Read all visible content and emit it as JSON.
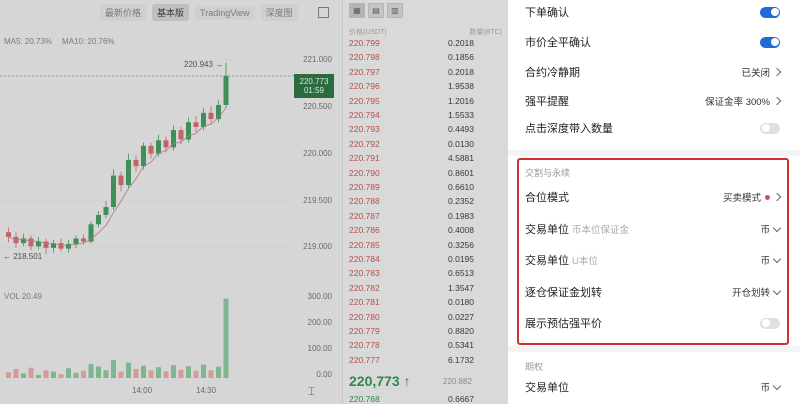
{
  "chart": {
    "toolbar": [
      "最新价格",
      "基本版",
      "TradingView",
      "深度图"
    ],
    "ma_legend": [
      "MA5: 20.73%",
      "MA10: 20.76%"
    ],
    "vol_legend": "VOL 20.49",
    "price_ticks": [
      "221.000",
      "220.500",
      "220.000",
      "219.500",
      "219.000"
    ],
    "vol_ticks": [
      "300.00",
      "200.00",
      "100.00",
      "0.00"
    ],
    "time_ticks": [
      "14:00",
      "14:30"
    ],
    "high_label": "220.943 →",
    "low_label": "← 218.501",
    "current_price_tag": {
      "price": "220.773",
      "sub": "01:59"
    },
    "candles": [
      {
        "o": 218.78,
        "c": 218.72,
        "h": 218.84,
        "l": 218.65
      },
      {
        "o": 218.72,
        "c": 218.64,
        "h": 218.78,
        "l": 218.58
      },
      {
        "o": 218.64,
        "c": 218.7,
        "h": 218.76,
        "l": 218.6
      },
      {
        "o": 218.7,
        "c": 218.6,
        "h": 218.74,
        "l": 218.55
      },
      {
        "o": 218.6,
        "c": 218.66,
        "h": 218.72,
        "l": 218.56
      },
      {
        "o": 218.66,
        "c": 218.58,
        "h": 218.7,
        "l": 218.5
      },
      {
        "o": 218.58,
        "c": 218.64,
        "h": 218.68,
        "l": 218.52
      },
      {
        "o": 218.64,
        "c": 218.57,
        "h": 218.7,
        "l": 218.53
      },
      {
        "o": 218.57,
        "c": 218.63,
        "h": 218.68,
        "l": 218.52
      },
      {
        "o": 218.63,
        "c": 218.7,
        "h": 218.74,
        "l": 218.58
      },
      {
        "o": 218.7,
        "c": 218.66,
        "h": 218.75,
        "l": 218.62
      },
      {
        "o": 218.66,
        "c": 218.88,
        "h": 218.92,
        "l": 218.64
      },
      {
        "o": 218.88,
        "c": 219.0,
        "h": 219.05,
        "l": 218.84
      },
      {
        "o": 219.0,
        "c": 219.1,
        "h": 219.18,
        "l": 218.96
      },
      {
        "o": 219.1,
        "c": 219.5,
        "h": 219.58,
        "l": 219.06
      },
      {
        "o": 219.5,
        "c": 219.38,
        "h": 219.55,
        "l": 219.3
      },
      {
        "o": 219.38,
        "c": 219.7,
        "h": 219.78,
        "l": 219.34
      },
      {
        "o": 219.7,
        "c": 219.62,
        "h": 219.76,
        "l": 219.55
      },
      {
        "o": 219.62,
        "c": 219.88,
        "h": 219.92,
        "l": 219.58
      },
      {
        "o": 219.88,
        "c": 219.78,
        "h": 219.92,
        "l": 219.72
      },
      {
        "o": 219.78,
        "c": 219.95,
        "h": 220.02,
        "l": 219.74
      },
      {
        "o": 219.95,
        "c": 219.86,
        "h": 220.0,
        "l": 219.8
      },
      {
        "o": 219.86,
        "c": 220.08,
        "h": 220.14,
        "l": 219.82
      },
      {
        "o": 220.08,
        "c": 219.96,
        "h": 220.12,
        "l": 219.9
      },
      {
        "o": 219.96,
        "c": 220.18,
        "h": 220.24,
        "l": 219.92
      },
      {
        "o": 220.18,
        "c": 220.12,
        "h": 220.26,
        "l": 220.06
      },
      {
        "o": 220.12,
        "c": 220.3,
        "h": 220.36,
        "l": 220.08
      },
      {
        "o": 220.3,
        "c": 220.22,
        "h": 220.38,
        "l": 220.16
      },
      {
        "o": 220.22,
        "c": 220.4,
        "h": 220.46,
        "l": 220.18
      },
      {
        "o": 220.4,
        "c": 220.77,
        "h": 220.94,
        "l": 220.36
      }
    ],
    "volumes": [
      22,
      35,
      18,
      40,
      12,
      30,
      25,
      15,
      38,
      20,
      28,
      55,
      45,
      30,
      70,
      25,
      60,
      35,
      48,
      30,
      42,
      26,
      50,
      32,
      46,
      28,
      52,
      30,
      44,
      310
    ]
  },
  "orderbook": {
    "header": {
      "price": "价格(USDT)",
      "qty": "数量(BTC)"
    },
    "asks": [
      {
        "p": "220.799",
        "q": "0.2018"
      },
      {
        "p": "220.798",
        "q": "0.1856"
      },
      {
        "p": "220.797",
        "q": "0.2018"
      },
      {
        "p": "220.796",
        "q": "1.9538"
      },
      {
        "p": "220.795",
        "q": "1.2016"
      },
      {
        "p": "220.794",
        "q": "1.5533"
      },
      {
        "p": "220.793",
        "q": "0.4493"
      },
      {
        "p": "220.792",
        "q": "0.0130"
      },
      {
        "p": "220.791",
        "q": "4.5881"
      },
      {
        "p": "220.790",
        "q": "0.8601"
      },
      {
        "p": "220.789",
        "q": "0.6610"
      },
      {
        "p": "220.788",
        "q": "0.2352"
      },
      {
        "p": "220.787",
        "q": "0.1983"
      },
      {
        "p": "220.786",
        "q": "0.4008"
      },
      {
        "p": "220.785",
        "q": "0.3256"
      },
      {
        "p": "220.784",
        "q": "0.0195"
      },
      {
        "p": "220.783",
        "q": "0.6513"
      },
      {
        "p": "220.782",
        "q": "1.3547"
      },
      {
        "p": "220.781",
        "q": "0.0180"
      },
      {
        "p": "220.780",
        "q": "0.0227"
      },
      {
        "p": "220.779",
        "q": "0.8820"
      },
      {
        "p": "220.778",
        "q": "0.5341"
      },
      {
        "p": "220.777",
        "q": "6.1732"
      }
    ],
    "last_price": "220,773 ↑",
    "last_price_sub": "220.882",
    "bid": {
      "p": "220.768",
      "q": "0.6667"
    }
  },
  "settings": {
    "rows_top": [
      {
        "label": "下单确认",
        "type": "toggle",
        "on": true
      },
      {
        "label": "市价全平确认",
        "type": "toggle",
        "on": true
      },
      {
        "label": "合约冷静期",
        "type": "link",
        "value": "已关闭"
      },
      {
        "label": "强平提醒",
        "type": "link",
        "value": "保证金率 300%"
      },
      {
        "label": "点击深度带入数量",
        "type": "toggle",
        "on": false
      }
    ],
    "section_trade": "交割与永续",
    "position_mode": {
      "label": "合位模式",
      "value": "买卖模式"
    },
    "unit_coin": {
      "label": "交易单位",
      "hint": "币本位保证金",
      "value": "币"
    },
    "unit_u": {
      "label": "交易单位",
      "hint": "U本位",
      "value": "币"
    },
    "margin_transfer": {
      "label": "逐仓保证金划转",
      "value": "开仓划转"
    },
    "show_liq": {
      "label": "展示预估强平价",
      "on": false
    },
    "section_options": "期权",
    "options_unit": {
      "label": "交易单位",
      "value": "币"
    }
  }
}
